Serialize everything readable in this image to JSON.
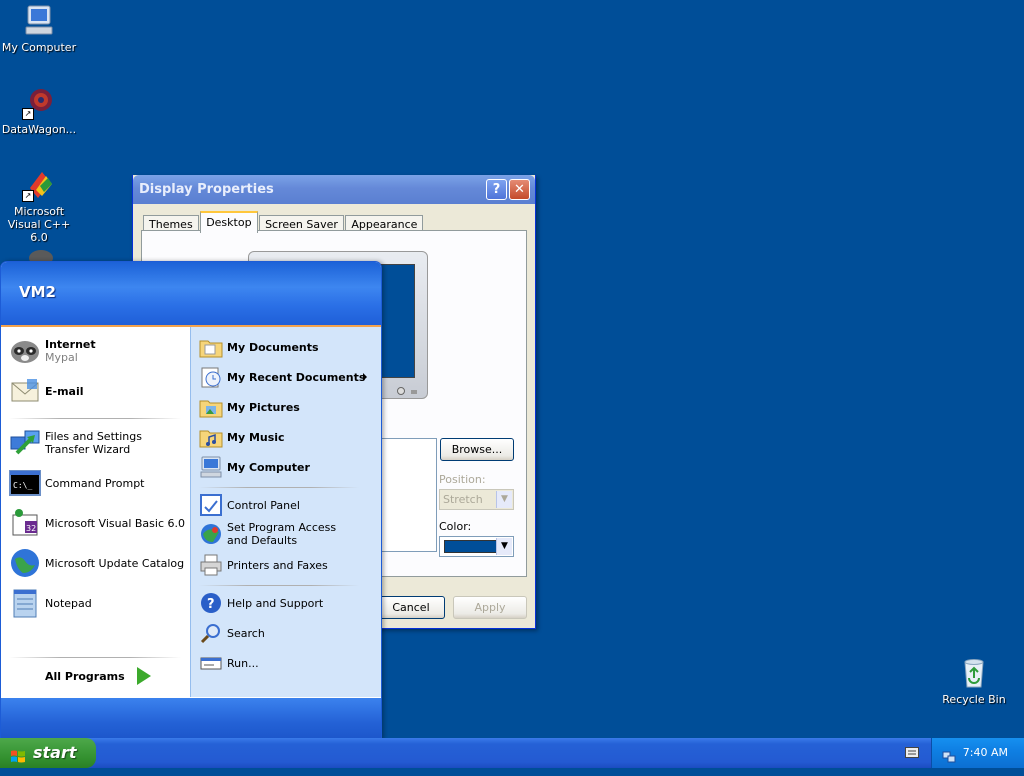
{
  "desktop": {
    "icons": [
      {
        "label": "My Computer"
      },
      {
        "label": "DataWagon..."
      },
      {
        "label": "Microsoft Visual C++ 6.0"
      },
      {
        "label": "Recycle Bin"
      }
    ]
  },
  "dialog": {
    "title": "Display Properties",
    "help_glyph": "?",
    "close_glyph": "✕",
    "tabs": [
      {
        "label": "Themes"
      },
      {
        "label": "Desktop"
      },
      {
        "label": "Screen Saver"
      },
      {
        "label": "Appearance"
      }
    ],
    "active_tab": "Desktop",
    "browse_label": "Browse...",
    "position_label": "Position:",
    "position_value": "Stretch",
    "color_label": "Color:",
    "color_value": "#004e98",
    "cancel_label": "Cancel",
    "apply_label": "Apply"
  },
  "start_menu": {
    "user": "VM2",
    "pinned": [
      {
        "title": "Internet",
        "subtitle": "Mypal",
        "icon": "mypal-raccoon-icon"
      },
      {
        "title": "E-mail",
        "icon": "email-envelope-icon"
      }
    ],
    "recent": [
      {
        "label": "Files and Settings Transfer Wizard",
        "icon": "transfer-wizard-icon"
      },
      {
        "label": "Command Prompt",
        "icon": "command-prompt-icon"
      },
      {
        "label": "Microsoft Visual Basic 6.0",
        "icon": "visual-basic-icon"
      },
      {
        "label": "Microsoft Update Catalog",
        "icon": "globe-icon"
      },
      {
        "label": "Notepad",
        "icon": "notepad-icon"
      }
    ],
    "all_programs": "All Programs",
    "right_places": [
      {
        "label": "My Documents",
        "icon": "folder-documents-icon"
      },
      {
        "label": "My Recent Documents",
        "icon": "recent-documents-icon",
        "submenu": true
      },
      {
        "label": "My Pictures",
        "icon": "folder-pictures-icon"
      },
      {
        "label": "My Music",
        "icon": "folder-music-icon"
      },
      {
        "label": "My Computer",
        "icon": "computer-icon"
      }
    ],
    "right_settings": [
      {
        "label": "Control Panel",
        "icon": "control-panel-icon"
      },
      {
        "label": "Set Program Access and Defaults",
        "icon": "program-access-icon"
      },
      {
        "label": "Printers and Faxes",
        "icon": "printer-icon"
      }
    ],
    "right_help": [
      {
        "label": "Help and Support",
        "icon": "help-icon"
      },
      {
        "label": "Search",
        "icon": "search-icon"
      },
      {
        "label": "Run...",
        "icon": "run-icon"
      }
    ]
  },
  "taskbar": {
    "start_label": "start",
    "clock": "7:40 AM"
  }
}
